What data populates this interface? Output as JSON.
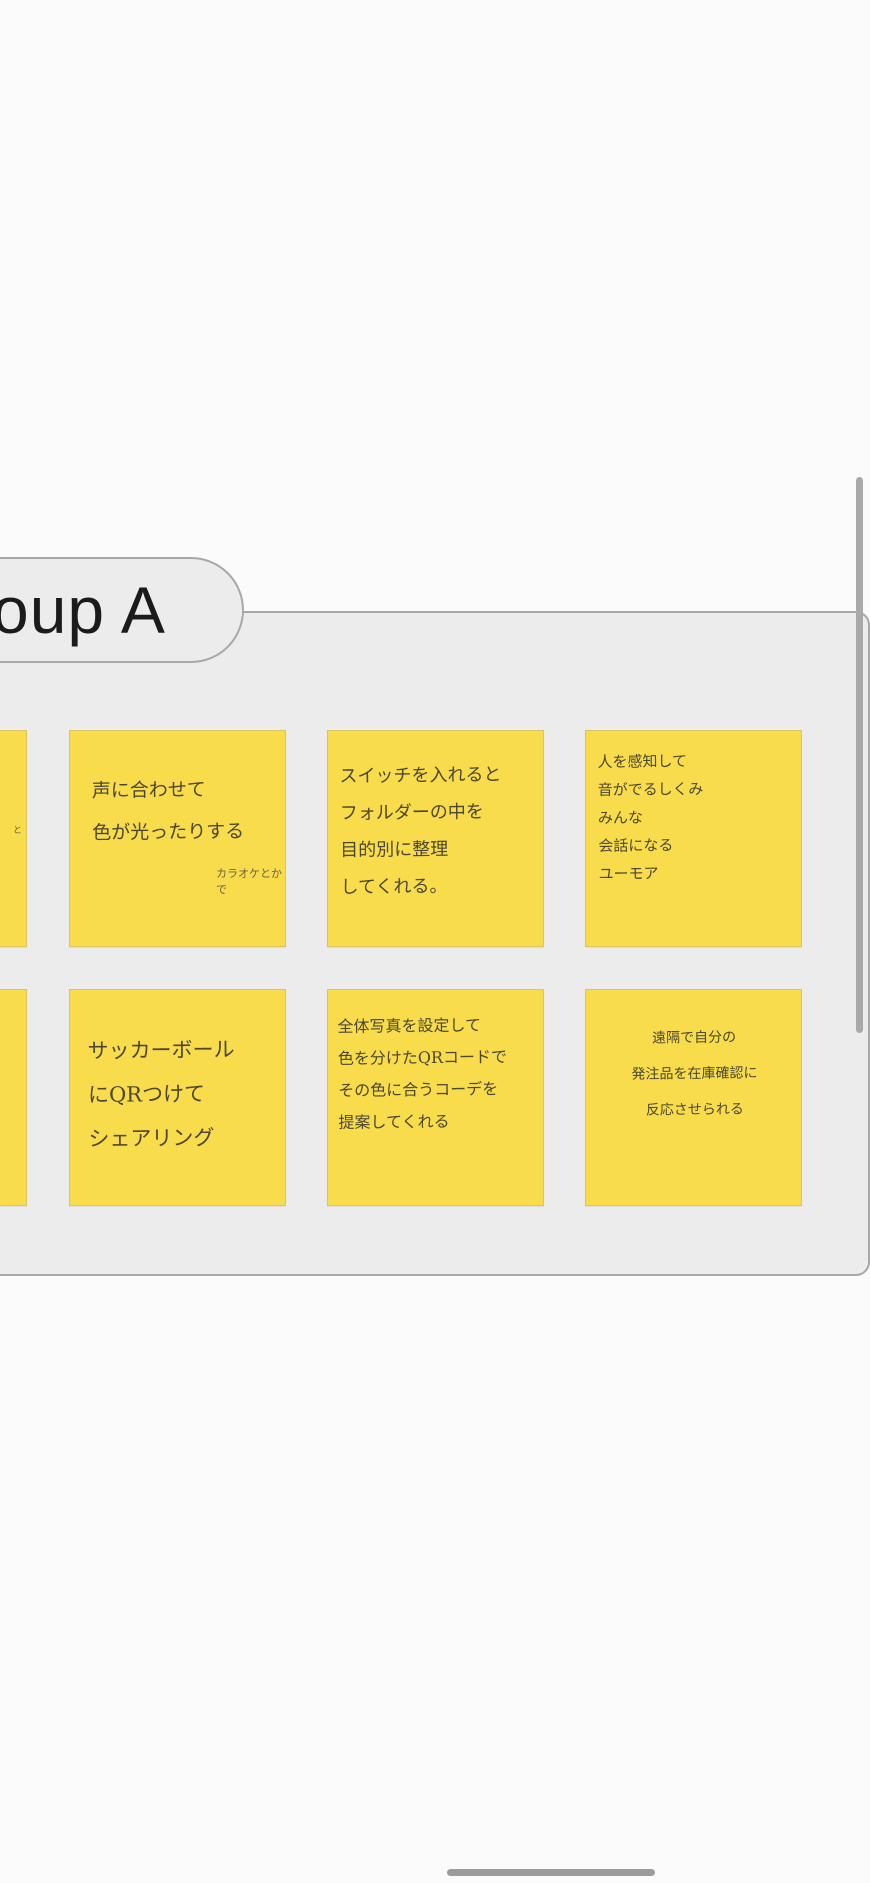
{
  "group": {
    "title": "oup A"
  },
  "notes": [
    {
      "id": "left-partial-1",
      "text": "",
      "extra": "と"
    },
    {
      "id": "note-1",
      "text": "声に合わせて\n色が光ったりする",
      "extra": "カラオケとかで"
    },
    {
      "id": "note-2",
      "text": "スイッチを入れると\nフォルダーの中を\n目的別に整理\nしてくれる。",
      "extra": ""
    },
    {
      "id": "note-3",
      "text": "人を感知して\n音がでるしくみ\nみんな\n会話になる\nユーモア",
      "extra": ""
    },
    {
      "id": "left-partial-2",
      "text": "",
      "extra": ""
    },
    {
      "id": "note-4",
      "text": "サッカーボール\nにQRつけて\nシェアリング",
      "extra": ""
    },
    {
      "id": "note-5",
      "text": "全体写真を設定して\n色を分けたQRコードで\nその色に合うコーデを\n提案してくれる",
      "extra": ""
    },
    {
      "id": "note-6",
      "text": "遠隔で自分の\n発注品を在庫確認に\n反応させられる",
      "extra": ""
    }
  ]
}
